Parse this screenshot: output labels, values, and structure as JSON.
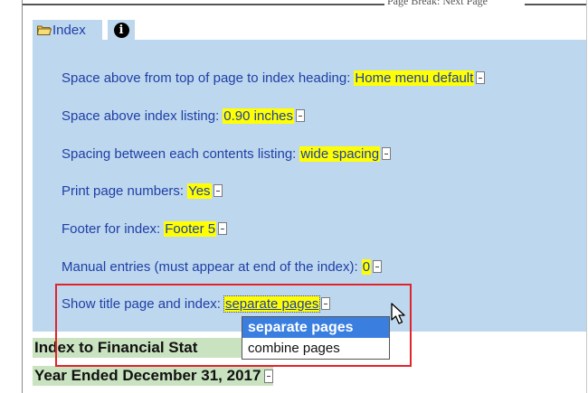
{
  "page_break": {
    "label": "Page Break: Next Page"
  },
  "tabs": {
    "index_label": "Index",
    "info_icon_glyph": "i"
  },
  "settings": {
    "rows": [
      {
        "label": "Space above from top of page to index heading:",
        "value": "Home menu default"
      },
      {
        "label": "Space above index listing:",
        "value": "0.90 inches"
      },
      {
        "label": "Spacing between each contents listing:",
        "value": "wide spacing"
      },
      {
        "label": "Print page numbers:",
        "value": "Yes"
      },
      {
        "label": "Footer for index:",
        "value": "Footer 5"
      },
      {
        "label": "Manual entries (must appear at end of the index):",
        "value": "0"
      },
      {
        "label": "Show title page and index:",
        "value": "separate pages"
      }
    ]
  },
  "dropdown": {
    "options": [
      "separate pages",
      "combine pages"
    ],
    "selected": "separate pages"
  },
  "document": {
    "heading1": "Index to Financial Stat",
    "heading2": "Year Ended December 31, 2017"
  },
  "colors": {
    "panel": "#bdd7ee",
    "highlight": "#ffff00",
    "label_text": "#1f3fa6",
    "heading_bg": "#c9e2c0",
    "callout_border": "#e0242b",
    "option_selected": "#3a7fe0"
  },
  "icons": {
    "folder": "folder-icon",
    "info": "info-icon",
    "cursor": "mouse-pointer-icon"
  }
}
